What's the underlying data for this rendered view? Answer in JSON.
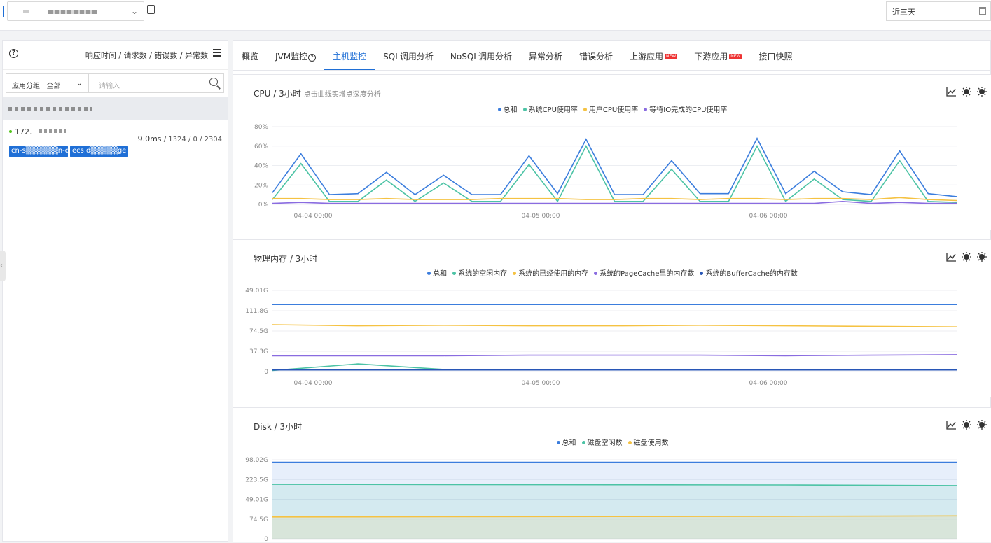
{
  "topbar": {
    "copy_icon": "copy-icon",
    "time_range": "近三天"
  },
  "left": {
    "metric_header": "响应时间 / 请求数 / 错误数 / 异常数",
    "filter": {
      "group_label": "应用分组",
      "group_value": "全部",
      "search_placeholder": "请输入"
    },
    "host": {
      "ip": "172.",
      "stats": "9.0ms",
      "stats_rest": " / 1324 / 0 / 2304",
      "tags": [
        "cn-s▒▒▒▒▒▒n-d",
        "ecs.d▒▒▒▒▒ge"
      ]
    }
  },
  "tabs": [
    {
      "label": "概览"
    },
    {
      "label": "JVM监控"
    },
    {
      "label": "主机监控",
      "active": true
    },
    {
      "label": "SQL调用分析"
    },
    {
      "label": "NoSQL调用分析"
    },
    {
      "label": "异常分析"
    },
    {
      "label": "错误分析"
    },
    {
      "label": "上游应用",
      "badge": "NEW"
    },
    {
      "label": "下游应用",
      "badge": "NEW"
    },
    {
      "label": "接口快照"
    }
  ],
  "panels": {
    "cpu": {
      "title": "CPU / 3小时",
      "hint": "点击曲线实增点深度分析"
    },
    "mem": {
      "title": "物理内存 / 3小时"
    },
    "disk": {
      "title": "Disk / 3小时"
    }
  },
  "colors": {
    "blue": "#3b7ddd",
    "teal": "#4cc3a5",
    "yellow": "#f5c242",
    "purple": "#8a6ce0",
    "navy": "#2856b6"
  },
  "chart_data": [
    {
      "type": "line",
      "title": "CPU / 3小时",
      "x_ticks": [
        "04-04 00:00",
        "04-05 00:00",
        "04-06 00:00"
      ],
      "y_ticks": [
        "80%",
        "60%",
        "40%",
        "20%",
        "0%"
      ],
      "ylim": [
        0,
        80
      ],
      "series": [
        {
          "name": "总和",
          "color": "#3b7ddd",
          "values": [
            12,
            52,
            10,
            11,
            33,
            10,
            30,
            10,
            10,
            50,
            11,
            67,
            10,
            10,
            45,
            11,
            11,
            68,
            11,
            34,
            13,
            10,
            55,
            11,
            8
          ]
        },
        {
          "name": "系统CPU使用率",
          "color": "#4cc3a5",
          "values": [
            5,
            42,
            3,
            3,
            25,
            3,
            22,
            3,
            3,
            41,
            3,
            60,
            3,
            3,
            36,
            3,
            3,
            60,
            3,
            26,
            5,
            3,
            45,
            3,
            2
          ]
        },
        {
          "name": "用户CPU使用率",
          "color": "#f5c242",
          "values": [
            6,
            6,
            5,
            5,
            6,
            5,
            5,
            5,
            6,
            6,
            6,
            5,
            5,
            6,
            6,
            5,
            6,
            6,
            5,
            6,
            6,
            5,
            7,
            5,
            4
          ]
        },
        {
          "name": "等待IO完成的CPU使用率",
          "color": "#8a6ce0",
          "values": [
            1,
            2,
            1,
            1,
            1,
            1,
            1,
            1,
            1,
            1,
            1,
            1,
            1,
            1,
            1,
            1,
            1,
            1,
            1,
            1,
            3,
            1,
            2,
            1,
            1
          ]
        }
      ]
    },
    {
      "type": "line",
      "title": "物理内存 / 3小时",
      "x_ticks": [
        "04-04 00:00",
        "04-05 00:00",
        "04-06 00:00"
      ],
      "y_ticks": [
        "49.01G",
        "111.8G",
        "74.5G",
        "37.3G",
        "0"
      ],
      "ylim": [
        0,
        149
      ],
      "series": [
        {
          "name": "总和",
          "color": "#3b7ddd",
          "values": [
            123,
            123,
            123,
            123,
            123,
            123,
            123,
            123,
            123
          ]
        },
        {
          "name": "系统的空闲内存",
          "color": "#4cc3a5",
          "values": [
            2,
            14,
            4,
            3,
            3,
            3,
            3,
            3,
            3
          ]
        },
        {
          "name": "系统的已经使用的内存",
          "color": "#f5c242",
          "values": [
            86,
            84,
            85,
            84,
            84,
            85,
            84,
            83,
            82
          ]
        },
        {
          "name": "系统的PageCache里的内存数",
          "color": "#8a6ce0",
          "values": [
            29,
            29,
            29,
            30,
            30,
            30,
            29,
            30,
            31
          ]
        },
        {
          "name": "系统的BufferCache的内存数",
          "color": "#2856b6",
          "values": [
            3,
            3,
            3,
            3,
            3,
            3,
            3,
            3,
            3
          ]
        }
      ]
    },
    {
      "type": "area",
      "title": "Disk / 3小时",
      "x_ticks": [],
      "y_ticks": [
        "98.02G",
        "223.5G",
        "49.01G",
        "74.5G",
        "0"
      ],
      "ylim": [
        0,
        380
      ],
      "series": [
        {
          "name": "总和",
          "color": "#3b7ddd",
          "values": [
            368,
            368,
            368,
            368,
            368
          ]
        },
        {
          "name": "磁盘空闲数",
          "color": "#4cc3a5",
          "values": [
            262,
            261,
            260,
            259,
            256
          ]
        },
        {
          "name": "磁盘使用数",
          "color": "#f5c242",
          "values": [
            105,
            106,
            107,
            108,
            110
          ]
        }
      ]
    }
  ]
}
